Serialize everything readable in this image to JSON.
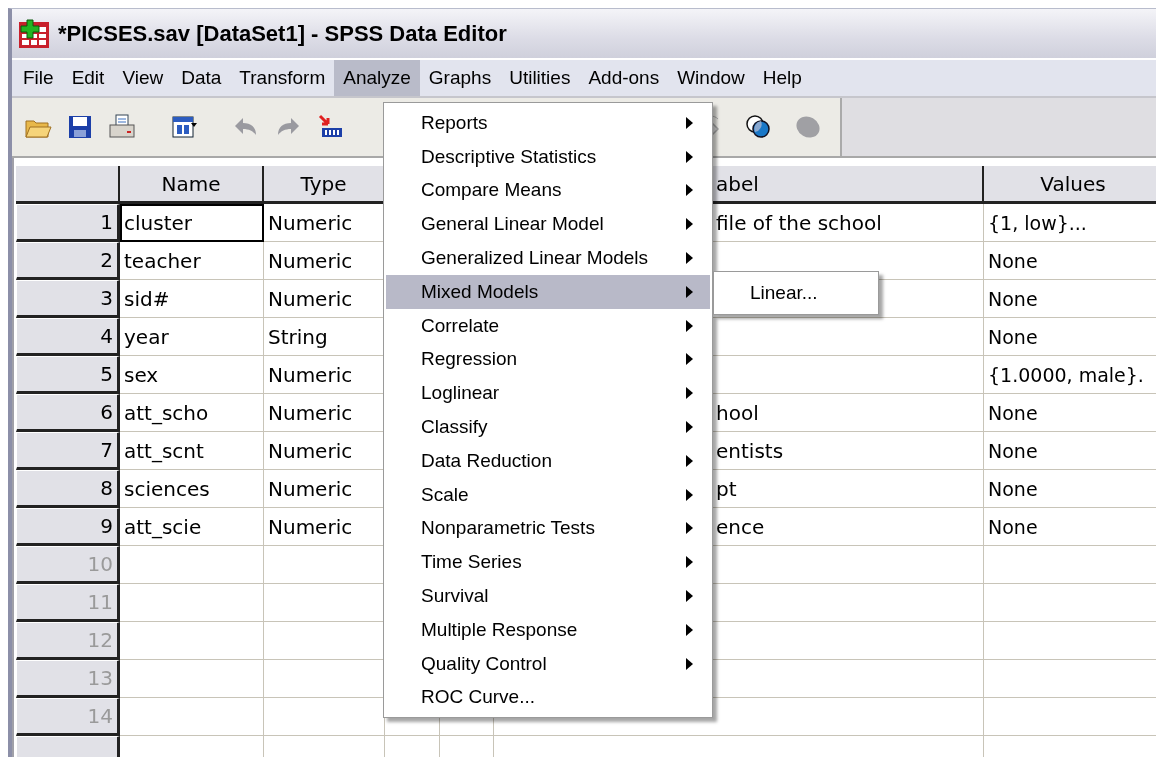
{
  "window": {
    "title": "*PICSES.sav [DataSet1] - SPSS Data Editor"
  },
  "menu_bar": [
    {
      "label": "File",
      "selected": false
    },
    {
      "label": "Edit",
      "selected": false
    },
    {
      "label": "View",
      "selected": false
    },
    {
      "label": "Data",
      "selected": false
    },
    {
      "label": "Transform",
      "selected": false
    },
    {
      "label": "Analyze",
      "selected": true
    },
    {
      "label": "Graphs",
      "selected": false
    },
    {
      "label": "Utilities",
      "selected": false
    },
    {
      "label": "Add-ons",
      "selected": false
    },
    {
      "label": "Window",
      "selected": false
    },
    {
      "label": "Help",
      "selected": false
    }
  ],
  "table": {
    "columns": [
      {
        "label": "Name"
      },
      {
        "label": "Type"
      },
      {
        "label": "abel"
      },
      {
        "label": "Values"
      }
    ],
    "rows": [
      {
        "number": "1",
        "name": "cluster",
        "type": "Numeric",
        "label": "file of the school",
        "values": "{1, low}...",
        "selected": true,
        "empty": false
      },
      {
        "number": "2",
        "name": "teacher",
        "type": "Numeric",
        "values": "None",
        "selected": false,
        "empty": false
      },
      {
        "number": "3",
        "name": "sid#",
        "type": "Numeric",
        "values": "None",
        "selected": false,
        "empty": false
      },
      {
        "number": "4",
        "name": "year",
        "type": "String",
        "values": "None",
        "selected": false,
        "empty": false
      },
      {
        "number": "5",
        "name": "sex",
        "type": "Numeric",
        "values": "{1.0000, male}.",
        "selected": false,
        "empty": false
      },
      {
        "number": "6",
        "name": "att_scho",
        "type": "Numeric",
        "label": "hool",
        "values": "None",
        "selected": false,
        "empty": false
      },
      {
        "number": "7",
        "name": "att_scnt",
        "type": "Numeric",
        "label": "entists",
        "values": "None",
        "selected": false,
        "empty": false
      },
      {
        "number": "8",
        "name": "sciences",
        "type": "Numeric",
        "label": "pt",
        "values": "None",
        "selected": false,
        "empty": false
      },
      {
        "number": "9",
        "name": "att_scie",
        "type": "Numeric",
        "label": "ence",
        "values": "None",
        "selected": false,
        "empty": false
      },
      {
        "number": "10",
        "selected": false,
        "empty": true
      },
      {
        "number": "11",
        "selected": false,
        "empty": true
      },
      {
        "number": "12",
        "selected": false,
        "empty": true
      },
      {
        "number": "13",
        "selected": false,
        "empty": true
      },
      {
        "number": "14",
        "selected": false,
        "empty": true
      }
    ]
  },
  "analyze_menu": {
    "items": [
      {
        "label": "Reports",
        "has_submenu": true,
        "selected": false
      },
      {
        "label": "Descriptive Statistics",
        "has_submenu": true,
        "selected": false
      },
      {
        "label": "Compare Means",
        "has_submenu": true,
        "selected": false
      },
      {
        "label": "General Linear Model",
        "has_submenu": true,
        "selected": false
      },
      {
        "label": "Generalized Linear Models",
        "has_submenu": true,
        "selected": false
      },
      {
        "label": "Mixed Models",
        "has_submenu": true,
        "selected": true
      },
      {
        "label": "Correlate",
        "has_submenu": true,
        "selected": false
      },
      {
        "label": "Regression",
        "has_submenu": true,
        "selected": false
      },
      {
        "label": "Loglinear",
        "has_submenu": true,
        "selected": false
      },
      {
        "label": "Classify",
        "has_submenu": true,
        "selected": false
      },
      {
        "label": "Data Reduction",
        "has_submenu": true,
        "selected": false
      },
      {
        "label": "Scale",
        "has_submenu": true,
        "selected": false
      },
      {
        "label": "Nonparametric Tests",
        "has_submenu": true,
        "selected": false
      },
      {
        "label": "Time Series",
        "has_submenu": true,
        "selected": false
      },
      {
        "label": "Survival",
        "has_submenu": true,
        "selected": false
      },
      {
        "label": "Multiple Response",
        "has_submenu": true,
        "selected": false
      },
      {
        "label": "Quality Control",
        "has_submenu": true,
        "selected": false
      },
      {
        "label": "ROC Curve...",
        "has_submenu": false,
        "selected": false
      }
    ],
    "submenu": [
      {
        "label": "Linear..."
      }
    ]
  }
}
